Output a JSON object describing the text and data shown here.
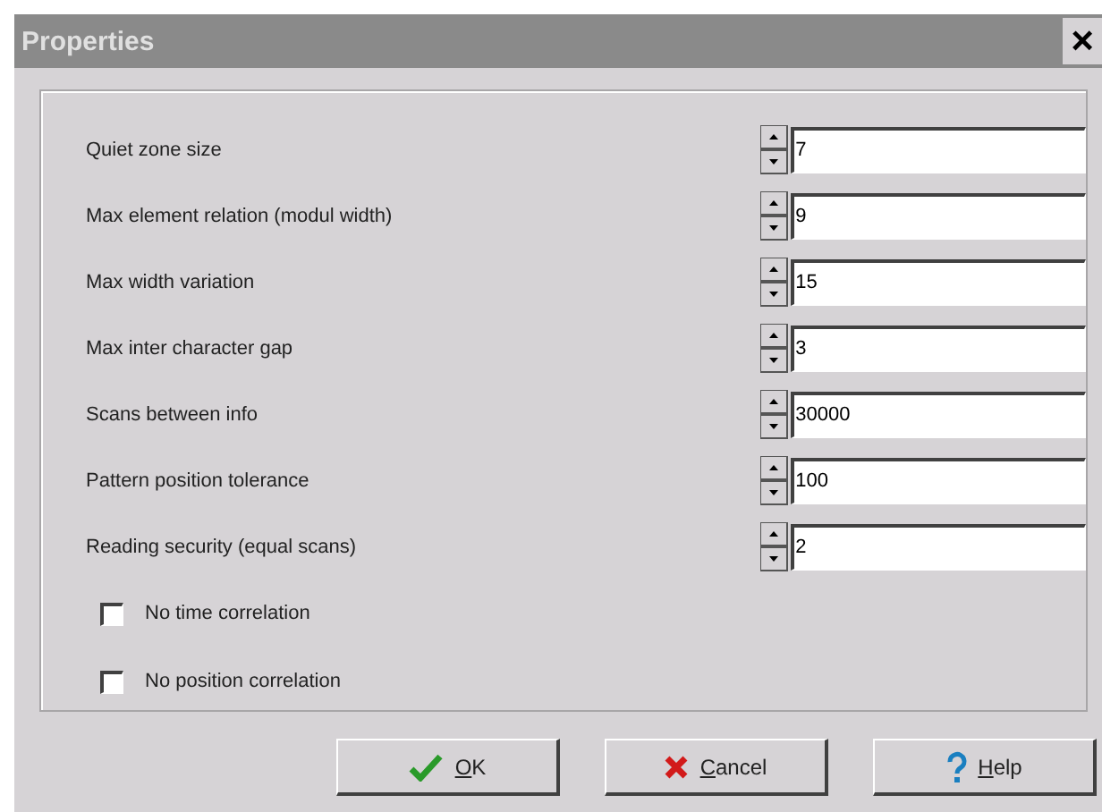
{
  "window": {
    "title": "Properties",
    "close": "×"
  },
  "fields": [
    {
      "label": "Quiet zone size",
      "value": "7"
    },
    {
      "label": "Max element relation (modul width)",
      "value": "9"
    },
    {
      "label": "Max width variation",
      "value": "15"
    },
    {
      "label": "Max inter character gap",
      "value": "3"
    },
    {
      "label": "Scans between info",
      "value": "30000"
    },
    {
      "label": "Pattern position tolerance",
      "value": "100"
    },
    {
      "label": "Reading security (equal scans)",
      "value": "2"
    }
  ],
  "checkboxes": [
    {
      "label": "No time correlation",
      "checked": false
    },
    {
      "label": "No position correlation",
      "checked": false
    }
  ],
  "buttons": [
    {
      "label": "OK",
      "kind": "ok",
      "underline_first": true
    },
    {
      "label": "Cancel",
      "kind": "cancel",
      "underline_first": true
    },
    {
      "label": "Help",
      "kind": "help",
      "underline_first": true
    }
  ]
}
